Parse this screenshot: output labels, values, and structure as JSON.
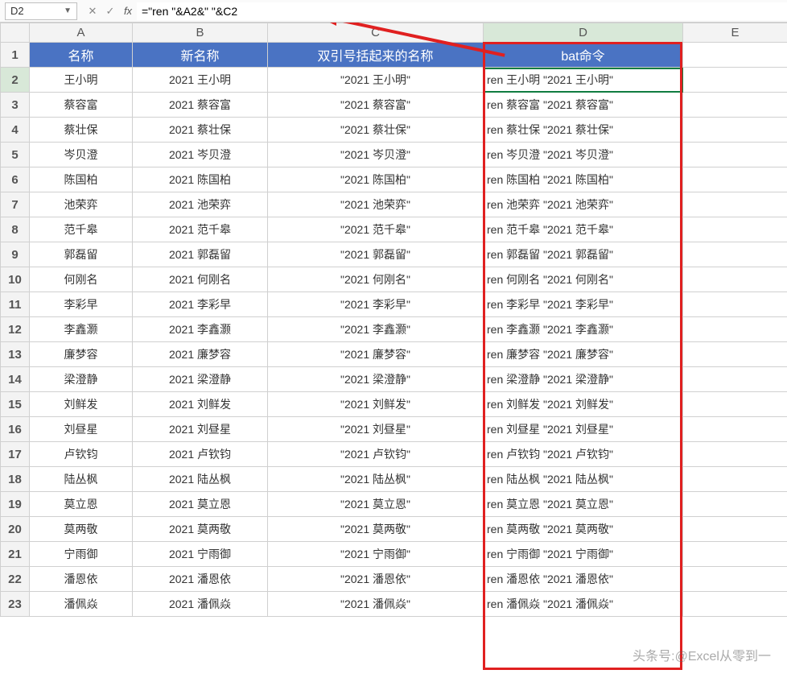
{
  "formula_bar": {
    "name_box": "D2",
    "fx_label": "fx",
    "formula": "=\"ren \"&A2&\" \"&C2"
  },
  "columns": [
    "A",
    "B",
    "C",
    "D",
    "E"
  ],
  "header_row": {
    "A": "名称",
    "B": "新名称",
    "C": "双引号括起来的名称",
    "D": "bat命令"
  },
  "rows": [
    {
      "n": "2",
      "a": "王小明",
      "b": "2021 王小明",
      "c": "\"2021 王小明\"",
      "d": "ren 王小明 \"2021 王小明\""
    },
    {
      "n": "3",
      "a": "蔡容富",
      "b": "2021 蔡容富",
      "c": "\"2021 蔡容富\"",
      "d": "ren 蔡容富 \"2021 蔡容富\""
    },
    {
      "n": "4",
      "a": "蔡壮保",
      "b": "2021 蔡壮保",
      "c": "\"2021 蔡壮保\"",
      "d": "ren 蔡壮保 \"2021 蔡壮保\""
    },
    {
      "n": "5",
      "a": "岑贝澄",
      "b": "2021 岑贝澄",
      "c": "\"2021 岑贝澄\"",
      "d": "ren 岑贝澄 \"2021 岑贝澄\""
    },
    {
      "n": "6",
      "a": "陈国柏",
      "b": "2021 陈国柏",
      "c": "\"2021 陈国柏\"",
      "d": "ren 陈国柏 \"2021 陈国柏\""
    },
    {
      "n": "7",
      "a": "池荣弈",
      "b": "2021 池荣弈",
      "c": "\"2021 池荣弈\"",
      "d": "ren 池荣弈 \"2021 池荣弈\""
    },
    {
      "n": "8",
      "a": "范千皋",
      "b": "2021 范千皋",
      "c": "\"2021 范千皋\"",
      "d": "ren 范千皋 \"2021 范千皋\""
    },
    {
      "n": "9",
      "a": "郭磊留",
      "b": "2021 郭磊留",
      "c": "\"2021 郭磊留\"",
      "d": "ren 郭磊留 \"2021 郭磊留\""
    },
    {
      "n": "10",
      "a": "何刚名",
      "b": "2021 何刚名",
      "c": "\"2021 何刚名\"",
      "d": "ren 何刚名 \"2021 何刚名\""
    },
    {
      "n": "11",
      "a": "李彩早",
      "b": "2021 李彩早",
      "c": "\"2021 李彩早\"",
      "d": "ren 李彩早 \"2021 李彩早\""
    },
    {
      "n": "12",
      "a": "李鑫灏",
      "b": "2021 李鑫灏",
      "c": "\"2021 李鑫灏\"",
      "d": "ren 李鑫灏 \"2021 李鑫灏\""
    },
    {
      "n": "13",
      "a": "廉梦容",
      "b": "2021 廉梦容",
      "c": "\"2021 廉梦容\"",
      "d": "ren 廉梦容 \"2021 廉梦容\""
    },
    {
      "n": "14",
      "a": "梁澄静",
      "b": "2021 梁澄静",
      "c": "\"2021 梁澄静\"",
      "d": "ren 梁澄静 \"2021 梁澄静\""
    },
    {
      "n": "15",
      "a": "刘鲜发",
      "b": "2021 刘鲜发",
      "c": "\"2021 刘鲜发\"",
      "d": "ren 刘鲜发 \"2021 刘鲜发\""
    },
    {
      "n": "16",
      "a": "刘昼星",
      "b": "2021 刘昼星",
      "c": "\"2021 刘昼星\"",
      "d": "ren 刘昼星 \"2021 刘昼星\""
    },
    {
      "n": "17",
      "a": "卢钦钧",
      "b": "2021 卢钦钧",
      "c": "\"2021 卢钦钧\"",
      "d": "ren 卢钦钧 \"2021 卢钦钧\""
    },
    {
      "n": "18",
      "a": "陆丛枫",
      "b": "2021 陆丛枫",
      "c": "\"2021 陆丛枫\"",
      "d": "ren 陆丛枫 \"2021 陆丛枫\""
    },
    {
      "n": "19",
      "a": "莫立恩",
      "b": "2021 莫立恩",
      "c": "\"2021 莫立恩\"",
      "d": "ren 莫立恩 \"2021 莫立恩\""
    },
    {
      "n": "20",
      "a": "莫两敬",
      "b": "2021 莫两敬",
      "c": "\"2021 莫两敬\"",
      "d": "ren 莫两敬 \"2021 莫两敬\""
    },
    {
      "n": "21",
      "a": "宁雨御",
      "b": "2021 宁雨御",
      "c": "\"2021 宁雨御\"",
      "d": "ren 宁雨御 \"2021 宁雨御\""
    },
    {
      "n": "22",
      "a": "潘恩依",
      "b": "2021 潘恩依",
      "c": "\"2021 潘恩依\"",
      "d": "ren 潘恩依 \"2021 潘恩依\""
    },
    {
      "n": "23",
      "a": "潘佩焱",
      "b": "2021 潘佩焱",
      "c": "\"2021 潘佩焱\"",
      "d": "ren 潘佩焱 \"2021 潘佩焱\""
    }
  ],
  "watermark": "头条号:@Excel从零到一"
}
